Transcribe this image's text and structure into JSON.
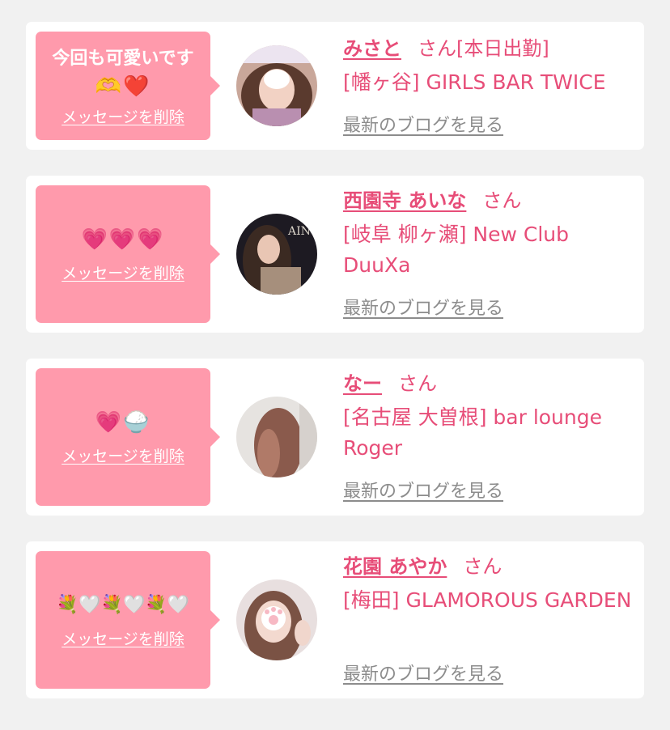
{
  "items": [
    {
      "message_text": "今回も可愛いです",
      "message_emoji": "🫶❤️",
      "delete_label": "メッセージを削除",
      "name": "みさと",
      "honorific": "さん",
      "status": "[本日出勤]",
      "shop": "[幡ヶ谷] GIRLS BAR TWICE",
      "blog_label": "最新のブログを見る"
    },
    {
      "message_text": "",
      "message_emoji": "💗💗💗",
      "delete_label": "メッセージを削除",
      "name": "西園寺 あいな",
      "honorific": "さん",
      "status": "",
      "shop": "[岐阜 柳ヶ瀬] New Club DuuXa",
      "blog_label": "最新のブログを見る"
    },
    {
      "message_text": "",
      "message_emoji": "💗🍚",
      "delete_label": "メッセージを削除",
      "name": "なー",
      "honorific": "さん",
      "status": "",
      "shop": "[名古屋 大曽根] bar lounge Roger",
      "blog_label": "最新のブログを見る"
    },
    {
      "message_text": "",
      "message_emoji": "💐🤍💐🤍💐🤍",
      "delete_label": "メッセージを削除",
      "name": "花園 あやか",
      "honorific": "さん",
      "status": "",
      "shop": "[梅田] GLAMOROUS GARDEN",
      "blog_label": "最新のブログを見る"
    }
  ]
}
